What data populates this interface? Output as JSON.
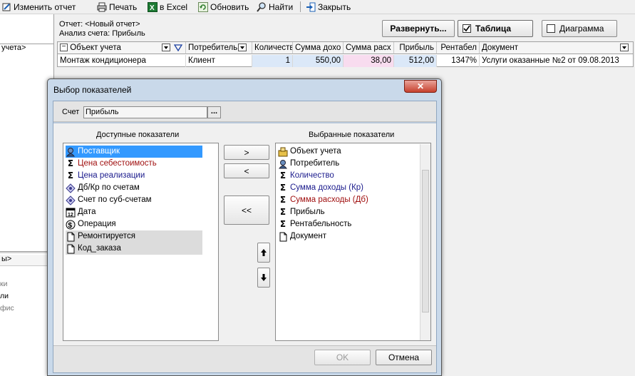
{
  "toolbar": {
    "edit_report": "Изменить отчет",
    "print": "Печать",
    "excel": "в Excel",
    "refresh": "Обновить",
    "find": "Найти",
    "close": "Закрыть"
  },
  "left_pane": {
    "top_item": "учета>",
    "bottom_items": [
      "ы>",
      "ки",
      "ли",
      "фис"
    ]
  },
  "report_info": {
    "report_line": "Отчет:  <Новый отчет>",
    "analysis_line": "Анализ счета:  Прибыль"
  },
  "view_buttons": {
    "expand": "Развернуть...",
    "table": "Таблица",
    "table_checked": true,
    "chart": "Диаграмма",
    "chart_checked": false
  },
  "grid": {
    "columns": [
      "Объект учета",
      "Потребитель",
      "Количество",
      "Сумма дохо",
      "Сумма расх",
      "Прибыль",
      "Рентабел",
      "Документ"
    ],
    "row": {
      "object": "Монтаж кондиционера",
      "consumer": "Клиент",
      "quantity": "1",
      "income": "550,00",
      "expense": "38,00",
      "profit": "512,00",
      "profitability": "1347%",
      "document": "Услуги оказанные №2 от 09.08.2013"
    }
  },
  "dialog": {
    "title": "Выбор показателей",
    "account_label": "Счет",
    "account_value": "Прибыль",
    "account_button": "...",
    "available_header": "Доступные показатели",
    "selected_header": "Выбранные показатели",
    "available": [
      {
        "label": "Поставщик",
        "icon": "person-icon",
        "color": "#ffffff",
        "selected": true
      },
      {
        "label": "Цена себестоимость",
        "icon": "sigma-icon",
        "color": "#a01010"
      },
      {
        "label": "Цена реализации",
        "icon": "sigma-icon",
        "color": "#1a1a8c"
      },
      {
        "label": "Дб/Кр по счетам",
        "icon": "diamond-icon",
        "color": "#000000"
      },
      {
        "label": "Счет по суб-счетам",
        "icon": "diamond-icon",
        "color": "#000000"
      },
      {
        "label": "Дата",
        "icon": "calendar-icon",
        "color": "#000000"
      },
      {
        "label": "Операция",
        "icon": "operation-icon",
        "color": "#000000"
      },
      {
        "label": "Ремонтируется",
        "icon": "document-icon",
        "color": "#000000",
        "shaded": true
      },
      {
        "label": "Код_заказа",
        "icon": "document-icon",
        "color": "#000000",
        "shaded": true
      }
    ],
    "selected": [
      {
        "label": "Объект учета",
        "icon": "object-icon",
        "color": "#000000"
      },
      {
        "label": "Потребитель",
        "icon": "person-icon",
        "color": "#000000"
      },
      {
        "label": "Количество",
        "icon": "sigma-icon",
        "color": "#1a1a8c"
      },
      {
        "label": "Сумма доходы (Кр)",
        "icon": "sigma-icon",
        "color": "#1a1a8c"
      },
      {
        "label": "Сумма расходы (Дб)",
        "icon": "sigma-icon",
        "color": "#a01010"
      },
      {
        "label": "Прибыль",
        "icon": "sigma-icon",
        "color": "#000000"
      },
      {
        "label": "Рентабельность",
        "icon": "sigma-icon",
        "color": "#000000"
      },
      {
        "label": "Документ",
        "icon": "document-icon",
        "color": "#000000"
      }
    ],
    "move_right": ">",
    "move_left": "<",
    "move_all_left": "<<",
    "ok": "OK",
    "cancel": "Отмена"
  }
}
